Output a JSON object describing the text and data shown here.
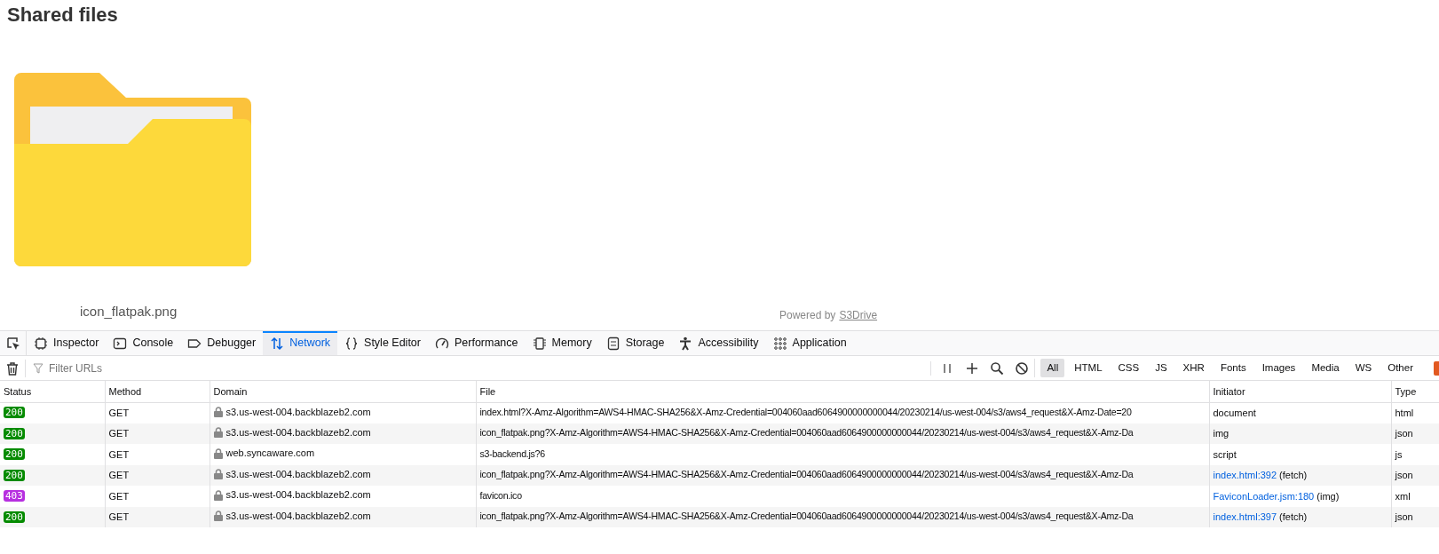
{
  "page": {
    "title": "Shared files",
    "files": [
      {
        "name": "icon_flatpak.png"
      }
    ],
    "footer": {
      "prefix": "Powered by",
      "link": "S3Drive"
    }
  },
  "devtools": {
    "tabs": [
      {
        "label": "Inspector",
        "selected": false
      },
      {
        "label": "Console",
        "selected": false
      },
      {
        "label": "Debugger",
        "selected": false
      },
      {
        "label": "Network",
        "selected": true
      },
      {
        "label": "Style Editor",
        "selected": false
      },
      {
        "label": "Performance",
        "selected": false
      },
      {
        "label": "Memory",
        "selected": false
      },
      {
        "label": "Storage",
        "selected": false
      },
      {
        "label": "Accessibility",
        "selected": false
      },
      {
        "label": "Application",
        "selected": false
      }
    ],
    "filter": {
      "placeholder": "Filter URLs"
    },
    "type_filters": [
      {
        "label": "All",
        "selected": true
      },
      {
        "label": "HTML",
        "selected": false
      },
      {
        "label": "CSS",
        "selected": false
      },
      {
        "label": "JS",
        "selected": false
      },
      {
        "label": "XHR",
        "selected": false
      },
      {
        "label": "Fonts",
        "selected": false
      },
      {
        "label": "Images",
        "selected": false
      },
      {
        "label": "Media",
        "selected": false
      },
      {
        "label": "WS",
        "selected": false
      },
      {
        "label": "Other",
        "selected": false
      }
    ],
    "table": {
      "columns": [
        "Status",
        "Method",
        "Domain",
        "File",
        "Initiator",
        "Type"
      ],
      "rows": [
        {
          "status": "200",
          "color": "#058b00",
          "method": "GET",
          "domain": "s3.us-west-004.backblazeb2.com",
          "file": "index.html?X-Amz-Algorithm=AWS4-HMAC-SHA256&X-Amz-Credential=004060aad6064900000000044/20230214/us-west-004/s3/aws4_request&X-Amz-Date=20",
          "initiator": "document",
          "type": "html"
        },
        {
          "status": "200",
          "color": "#058b00",
          "method": "GET",
          "domain": "s3.us-west-004.backblazeb2.com",
          "file": "icon_flatpak.png?X-Amz-Algorithm=AWS4-HMAC-SHA256&X-Amz-Credential=004060aad6064900000000044/20230214/us-west-004/s3/aws4_request&X-Amz-Da",
          "initiator": "img",
          "type": "json"
        },
        {
          "status": "200",
          "color": "#058b00",
          "method": "GET",
          "domain": "web.syncaware.com",
          "file": "s3-backend.js?6",
          "initiator": "script",
          "type": "js"
        },
        {
          "status": "200",
          "color": "#058b00",
          "method": "GET",
          "domain": "s3.us-west-004.backblazeb2.com",
          "file": "icon_flatpak.png?X-Amz-Algorithm=AWS4-HMAC-SHA256&X-Amz-Credential=004060aad6064900000000044/20230214/us-west-004/s3/aws4_request&X-Amz-Da",
          "initiator_link": "index.html:392",
          "initiator_note": "(fetch)",
          "type": "json"
        },
        {
          "status": "403",
          "color": "#b72fe0",
          "method": "GET",
          "domain": "s3.us-west-004.backblazeb2.com",
          "file": "favicon.ico",
          "initiator_link": "FaviconLoader.jsm:180",
          "initiator_note": "(img)",
          "type": "xml"
        },
        {
          "status": "200",
          "color": "#058b00",
          "method": "GET",
          "domain": "s3.us-west-004.backblazeb2.com",
          "file": "icon_flatpak.png?X-Amz-Algorithm=AWS4-HMAC-SHA256&X-Amz-Credential=004060aad6064900000000044/20230214/us-west-004/s3/aws4_request&X-Amz-Da",
          "initiator_link": "index.html:397",
          "initiator_note": "(fetch)",
          "type": "json"
        }
      ]
    }
  }
}
